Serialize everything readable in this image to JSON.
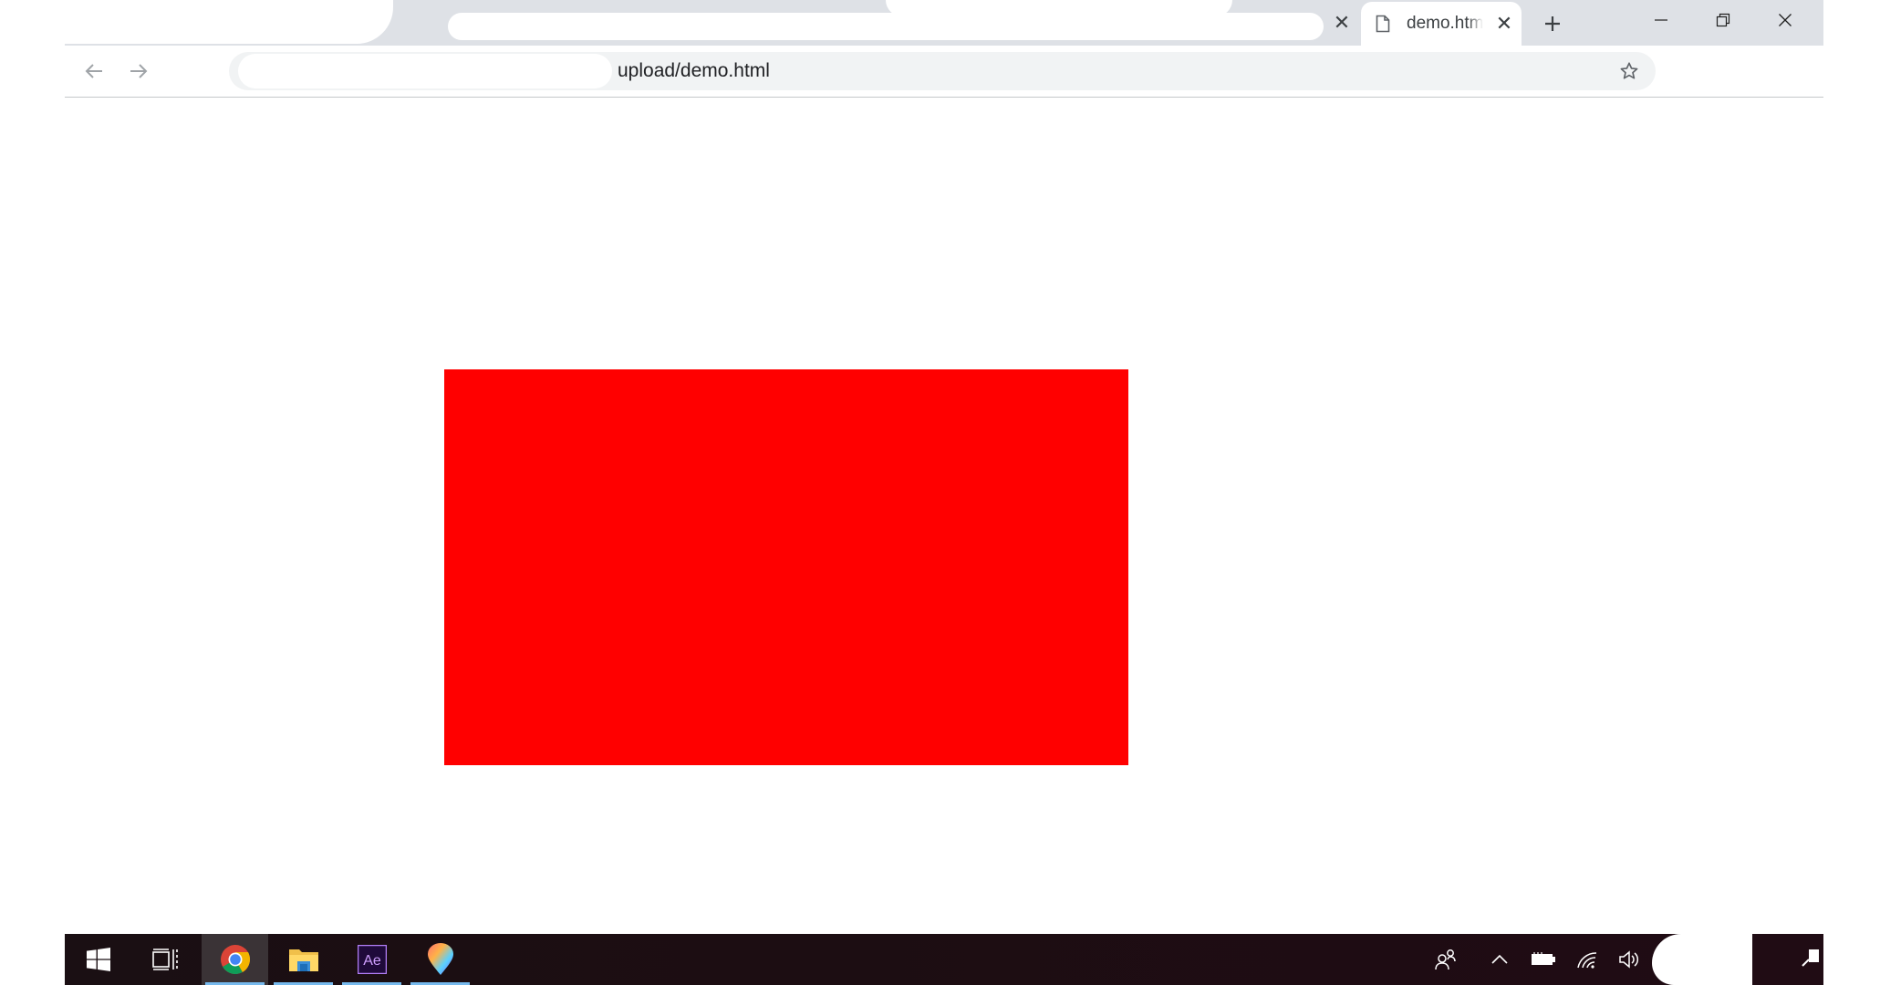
{
  "browser": {
    "tab": {
      "title": "demo.html"
    },
    "address_bar": {
      "url": "upload/demo.html"
    }
  },
  "page": {
    "box_color": "#ff0000"
  },
  "taskbar": {
    "apps": [
      {
        "name": "chrome-icon",
        "active": true
      },
      {
        "name": "file-explorer-icon",
        "active": false
      },
      {
        "name": "after-effects-icon",
        "label": "Ae",
        "active": false
      },
      {
        "name": "paint-3d-icon",
        "active": false
      }
    ]
  }
}
